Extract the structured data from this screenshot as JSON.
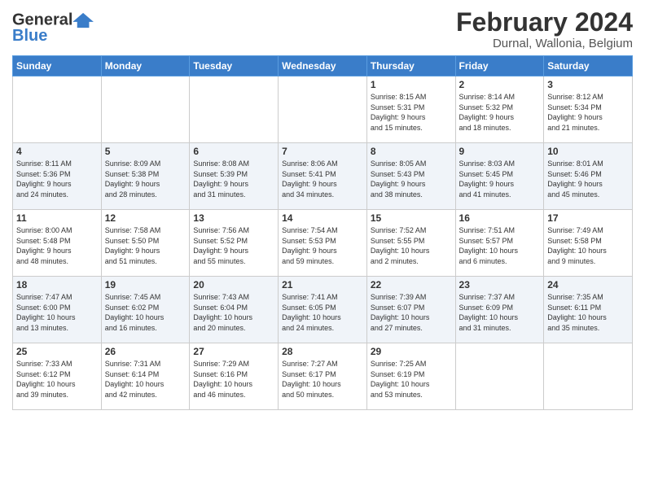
{
  "header": {
    "logo_general": "General",
    "logo_blue": "Blue",
    "title": "February 2024",
    "subtitle": "Durnal, Wallonia, Belgium"
  },
  "days_of_week": [
    "Sunday",
    "Monday",
    "Tuesday",
    "Wednesday",
    "Thursday",
    "Friday",
    "Saturday"
  ],
  "weeks": [
    [
      {
        "num": "",
        "info": ""
      },
      {
        "num": "",
        "info": ""
      },
      {
        "num": "",
        "info": ""
      },
      {
        "num": "",
        "info": ""
      },
      {
        "num": "1",
        "info": "Sunrise: 8:15 AM\nSunset: 5:31 PM\nDaylight: 9 hours\nand 15 minutes."
      },
      {
        "num": "2",
        "info": "Sunrise: 8:14 AM\nSunset: 5:32 PM\nDaylight: 9 hours\nand 18 minutes."
      },
      {
        "num": "3",
        "info": "Sunrise: 8:12 AM\nSunset: 5:34 PM\nDaylight: 9 hours\nand 21 minutes."
      }
    ],
    [
      {
        "num": "4",
        "info": "Sunrise: 8:11 AM\nSunset: 5:36 PM\nDaylight: 9 hours\nand 24 minutes."
      },
      {
        "num": "5",
        "info": "Sunrise: 8:09 AM\nSunset: 5:38 PM\nDaylight: 9 hours\nand 28 minutes."
      },
      {
        "num": "6",
        "info": "Sunrise: 8:08 AM\nSunset: 5:39 PM\nDaylight: 9 hours\nand 31 minutes."
      },
      {
        "num": "7",
        "info": "Sunrise: 8:06 AM\nSunset: 5:41 PM\nDaylight: 9 hours\nand 34 minutes."
      },
      {
        "num": "8",
        "info": "Sunrise: 8:05 AM\nSunset: 5:43 PM\nDaylight: 9 hours\nand 38 minutes."
      },
      {
        "num": "9",
        "info": "Sunrise: 8:03 AM\nSunset: 5:45 PM\nDaylight: 9 hours\nand 41 minutes."
      },
      {
        "num": "10",
        "info": "Sunrise: 8:01 AM\nSunset: 5:46 PM\nDaylight: 9 hours\nand 45 minutes."
      }
    ],
    [
      {
        "num": "11",
        "info": "Sunrise: 8:00 AM\nSunset: 5:48 PM\nDaylight: 9 hours\nand 48 minutes."
      },
      {
        "num": "12",
        "info": "Sunrise: 7:58 AM\nSunset: 5:50 PM\nDaylight: 9 hours\nand 51 minutes."
      },
      {
        "num": "13",
        "info": "Sunrise: 7:56 AM\nSunset: 5:52 PM\nDaylight: 9 hours\nand 55 minutes."
      },
      {
        "num": "14",
        "info": "Sunrise: 7:54 AM\nSunset: 5:53 PM\nDaylight: 9 hours\nand 59 minutes."
      },
      {
        "num": "15",
        "info": "Sunrise: 7:52 AM\nSunset: 5:55 PM\nDaylight: 10 hours\nand 2 minutes."
      },
      {
        "num": "16",
        "info": "Sunrise: 7:51 AM\nSunset: 5:57 PM\nDaylight: 10 hours\nand 6 minutes."
      },
      {
        "num": "17",
        "info": "Sunrise: 7:49 AM\nSunset: 5:58 PM\nDaylight: 10 hours\nand 9 minutes."
      }
    ],
    [
      {
        "num": "18",
        "info": "Sunrise: 7:47 AM\nSunset: 6:00 PM\nDaylight: 10 hours\nand 13 minutes."
      },
      {
        "num": "19",
        "info": "Sunrise: 7:45 AM\nSunset: 6:02 PM\nDaylight: 10 hours\nand 16 minutes."
      },
      {
        "num": "20",
        "info": "Sunrise: 7:43 AM\nSunset: 6:04 PM\nDaylight: 10 hours\nand 20 minutes."
      },
      {
        "num": "21",
        "info": "Sunrise: 7:41 AM\nSunset: 6:05 PM\nDaylight: 10 hours\nand 24 minutes."
      },
      {
        "num": "22",
        "info": "Sunrise: 7:39 AM\nSunset: 6:07 PM\nDaylight: 10 hours\nand 27 minutes."
      },
      {
        "num": "23",
        "info": "Sunrise: 7:37 AM\nSunset: 6:09 PM\nDaylight: 10 hours\nand 31 minutes."
      },
      {
        "num": "24",
        "info": "Sunrise: 7:35 AM\nSunset: 6:11 PM\nDaylight: 10 hours\nand 35 minutes."
      }
    ],
    [
      {
        "num": "25",
        "info": "Sunrise: 7:33 AM\nSunset: 6:12 PM\nDaylight: 10 hours\nand 39 minutes."
      },
      {
        "num": "26",
        "info": "Sunrise: 7:31 AM\nSunset: 6:14 PM\nDaylight: 10 hours\nand 42 minutes."
      },
      {
        "num": "27",
        "info": "Sunrise: 7:29 AM\nSunset: 6:16 PM\nDaylight: 10 hours\nand 46 minutes."
      },
      {
        "num": "28",
        "info": "Sunrise: 7:27 AM\nSunset: 6:17 PM\nDaylight: 10 hours\nand 50 minutes."
      },
      {
        "num": "29",
        "info": "Sunrise: 7:25 AM\nSunset: 6:19 PM\nDaylight: 10 hours\nand 53 minutes."
      },
      {
        "num": "",
        "info": ""
      },
      {
        "num": "",
        "info": ""
      }
    ]
  ]
}
